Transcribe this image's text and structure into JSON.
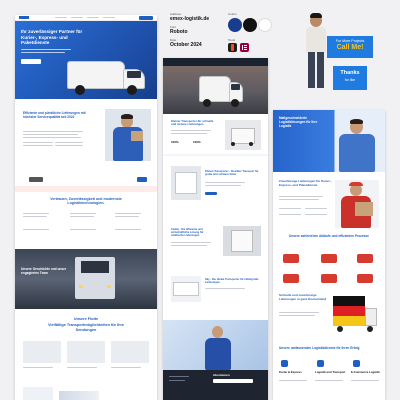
{
  "style_guide": {
    "address_label": "Address",
    "address_value": "emex-logistik.de",
    "font_label": "Font",
    "font_value": "Roboto",
    "date_label": "Date",
    "date_value": "October 2024",
    "colors_label": "Colors",
    "tools_label": "Tools",
    "colors": [
      "#1a3c8f",
      "#111111",
      "#ffffff"
    ],
    "tools": [
      {
        "icon": "figma-icon",
        "color": "#1e1e1e"
      },
      {
        "icon": "elementor-icon",
        "color": "#92003b"
      }
    ]
  },
  "cta": {
    "more_projects": "For More Projects",
    "call_me": "Call Me!",
    "thanks": "Thanks",
    "for_like": "for like",
    "bg": "#1f7be0",
    "badge_bg": "#f6c41a"
  },
  "left_page": {
    "hero_title": "Ihr zuverlässiger Partner für Kurier-, Express- und Paketdienste",
    "efficient_title": "Effiziente und pünktliche Lieferungen mit höchster Servicequalität seit 2022",
    "trust_title": "Vertrauen, Zuverlässigkeit und modernste Logistiktechnologien.",
    "history_title": "Unsere Geschichte und unser engagiertes Team",
    "fleet_title": "Unsere Flotte",
    "fleet_subtitle": "Vielfältige Transportmöglichkeiten für Ihre Sendungen"
  },
  "middle_page": {
    "nav_items": [
      "Home",
      "Leistungen",
      "Flotte",
      "Über uns",
      "Kontakt"
    ],
    "cargo_title": "Kleiner Transporter für schnelle und sichere Lieferungen",
    "stat_a": "100%",
    "stat_b": "100%",
    "panel_van_title": "Planen Transporter - Flexibler Transport für große und schwere Güter",
    "caddy_title": "Caddy - Die effiziente und wirtschaftliche Lösung für städtische Lieferungen",
    "sky_title": "Sky - Der ideale Transporter für mittelgroße Lieferungen",
    "subscribe_title": "Abonnieren"
  },
  "right_page": {
    "service_title": "Maßgeschneiderte Logistiklösungen für Ihre Logistik",
    "delivery_title": "Zuverlässige Lieferungen für Kurier-, Express- und Paketdienste",
    "process_title": "Unsere zahlreichen Abläufe und effizienten Prozesse",
    "germany_title": "Schnelle und zuverlässige Lieferungen in ganz Deutschland",
    "services_title": "Unsere umfassenden Logistikdienste für Ihren Erfolg",
    "service_cols": [
      "Kurier & Express",
      "Logistik und Transport",
      "E-Commerce Logistik"
    ]
  }
}
